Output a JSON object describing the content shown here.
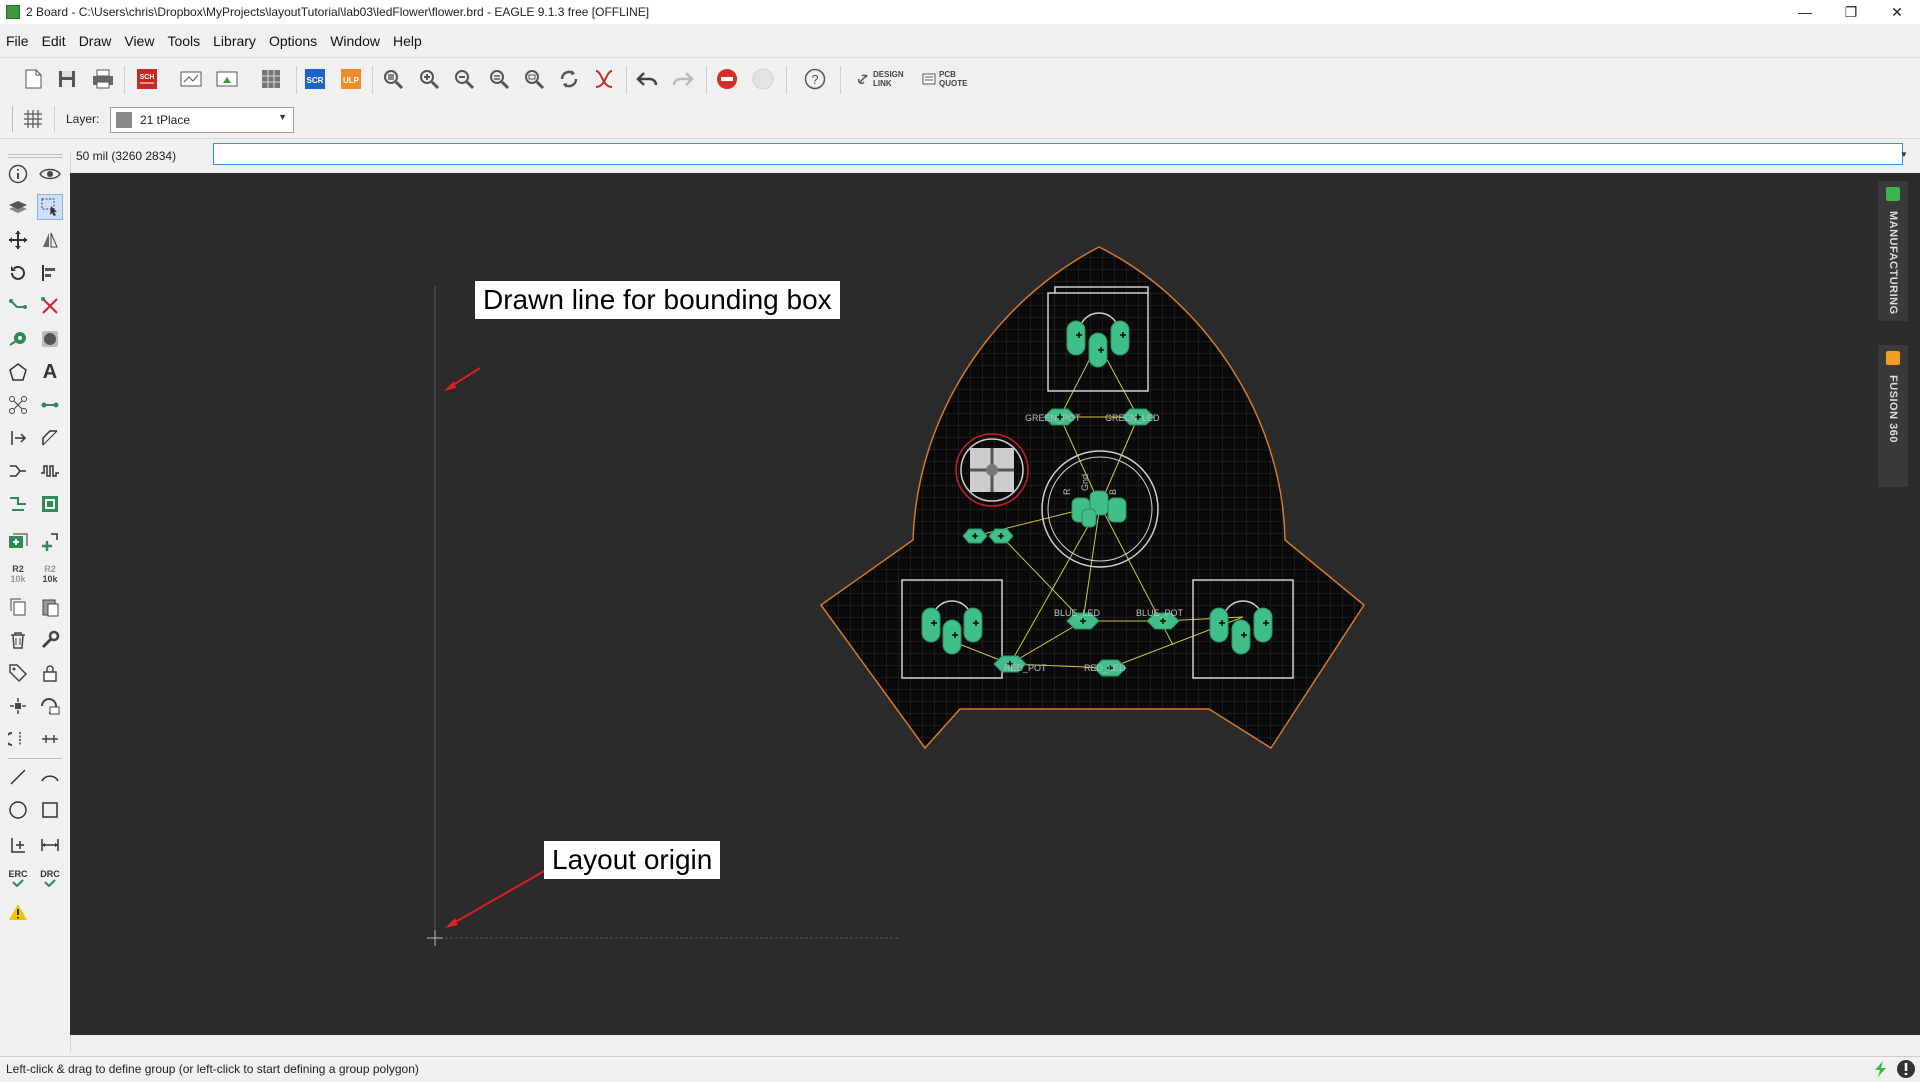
{
  "window": {
    "title": "2 Board - C:\\Users\\chris\\Dropbox\\MyProjects\\layoutTutorial\\lab03\\ledFlower\\flower.brd - EAGLE 9.1.3 free [OFFLINE]",
    "minimize": "—",
    "restore": "❐",
    "close": "✕"
  },
  "menu": {
    "items": [
      "File",
      "Edit",
      "Draw",
      "View",
      "Tools",
      "Library",
      "Options",
      "Window",
      "Help"
    ]
  },
  "toolbar": {
    "sch_label": "SCH",
    "scr_label": "SCR",
    "ulp_label": "ULP",
    "design_link_line1": "DESIGN",
    "design_link_line2": "LINK",
    "pcb_quote_line1": "PCB",
    "pcb_quote_line2": "QUOTE"
  },
  "layer_bar": {
    "label": "Layer:",
    "selected": "21 tPlace",
    "swatch_color": "#8a8a8a"
  },
  "command_bar": {
    "coordinates": "50 mil (3260 2834)",
    "input_value": ""
  },
  "left_toolbar": {
    "r2_top": "R2",
    "r2_bottom": "10k",
    "erc_label": "ERC",
    "drc_label": "DRC"
  },
  "board": {
    "labels": {
      "green_pot": "GREEN_POT",
      "green_led": "GREEN_LED",
      "blue_led": "BLUE_LED",
      "blue_pot": "BLUE_POT",
      "red_pot": "RED_POT",
      "red_led": "RED_LED",
      "r": "R",
      "gnd": "Gnd",
      "b": "B"
    },
    "colors": {
      "outline": "#d47a2a",
      "pad": "#3fbf8a",
      "airwire": "#c8c840",
      "silk": "#d0d0d0",
      "board_fill": "#0a0a0a",
      "grid": "#2a2a2a",
      "red_ring": "#c81e1e"
    }
  },
  "annotations": {
    "bounding_box_note": "Drawn line for bounding box",
    "origin_note": "Layout origin",
    "arrow_color": "#e02020"
  },
  "right_tabs": {
    "manufacturing": "MANUFACTURING",
    "fusion": "FUSION 360",
    "manufacturing_badge": "#3bb54a",
    "fusion_badge": "#f0a020"
  },
  "status": {
    "text": "Left-click & drag to define group (or left-click to start defining a group polygon)"
  }
}
